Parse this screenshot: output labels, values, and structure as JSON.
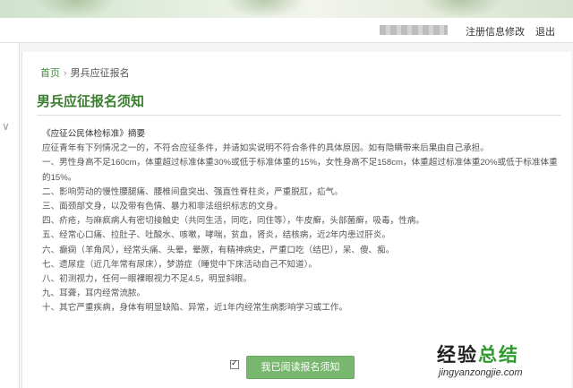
{
  "header": {
    "links": [
      "注册信息修改",
      "退出"
    ]
  },
  "breadcrumb": {
    "home": "首页",
    "separator": "›",
    "current": "男兵应征报名"
  },
  "page": {
    "title": "男兵应征报名须知"
  },
  "notice": {
    "heading": "《应征公民体检标准》摘要",
    "intro": "应征青年有下列情况之一的，不符合应征条件，并请如实说明不符合条件的具体原因。如有隐瞒带来后果由自己承担。",
    "items": [
      "一、男性身高不足160cm，体重超过标准体重30%或低于标准体重的15%，女性身高不足158cm，体重超过标准体重20%或低于标准体重的15%。",
      "二、影响劳动的慢性腰腿痛、腰椎间盘突出、强直性脊柱炎，严重脱肛，疝气。",
      "三、面颈部文身，以及带有色情、暴力和非法组织标志的文身。",
      "四、疥疮，与麻疯病人有密切接触史（共同生活，同吃，同住等），牛皮癣，头部菌癣，吸毒，性病。",
      "五、经常心口痛、拉肚子、吐酸水、咳嗽，哮喘，贫血，肾炎，结核病，近2年内患过肝炎。",
      "六、癫痫（羊角风），经常头痛、头晕，晕厥，有精神病史，严重口吃（结巴），呆、傻、痴。",
      "七、遗尿症（近几年常有尿床），梦游症（睡觉中下床活动自己不知道）。",
      "八、初测视力，任何一眼裸眼视力不足4.5，明显斜眼。",
      "九、耳聋，耳内经常流脓。",
      "十、其它严重疾病，身体有明显缺陷、异常，近1年内经常生病影响学习或工作。"
    ]
  },
  "agree": {
    "checked": true,
    "button_label": "我已阅读报名须知"
  },
  "watermark": {
    "brand_a": "经验",
    "brand_b": "总结",
    "url": "jingyanzongjie.com"
  }
}
